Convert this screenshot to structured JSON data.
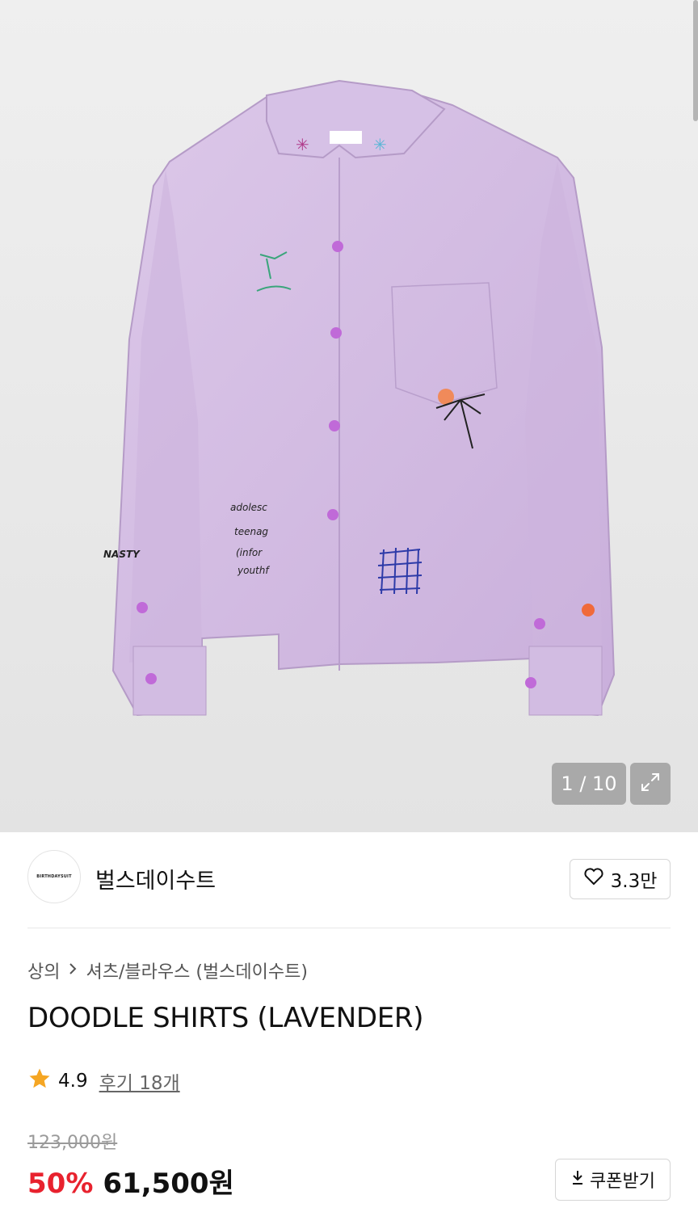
{
  "gallery": {
    "counter": "1 / 10",
    "expand_icon": "expand-icon",
    "image_subject": "lavender-doodle-shirt"
  },
  "brand": {
    "logo_text": "BIRTHDAYSUIT",
    "name": "벌스데이수트",
    "likes": "3.3만",
    "like_icon": "heart-outline-icon"
  },
  "breadcrumb": {
    "category": "상의",
    "separator_icon": "chevron-right-icon",
    "subcategory": "셔츠/블라우스 (벌스데이수트)"
  },
  "product": {
    "title": "DOODLE SHIRTS (LAVENDER)",
    "rating": "4.9",
    "reviews": "후기 18개",
    "original_price": "123,000원",
    "discount": "50%",
    "sale_price": "61,500원",
    "coupon_label": "쿠폰받기"
  },
  "colors": {
    "accent_red": "#e8222e",
    "star": "#f5a623",
    "shirt": "#d9c3e6"
  }
}
